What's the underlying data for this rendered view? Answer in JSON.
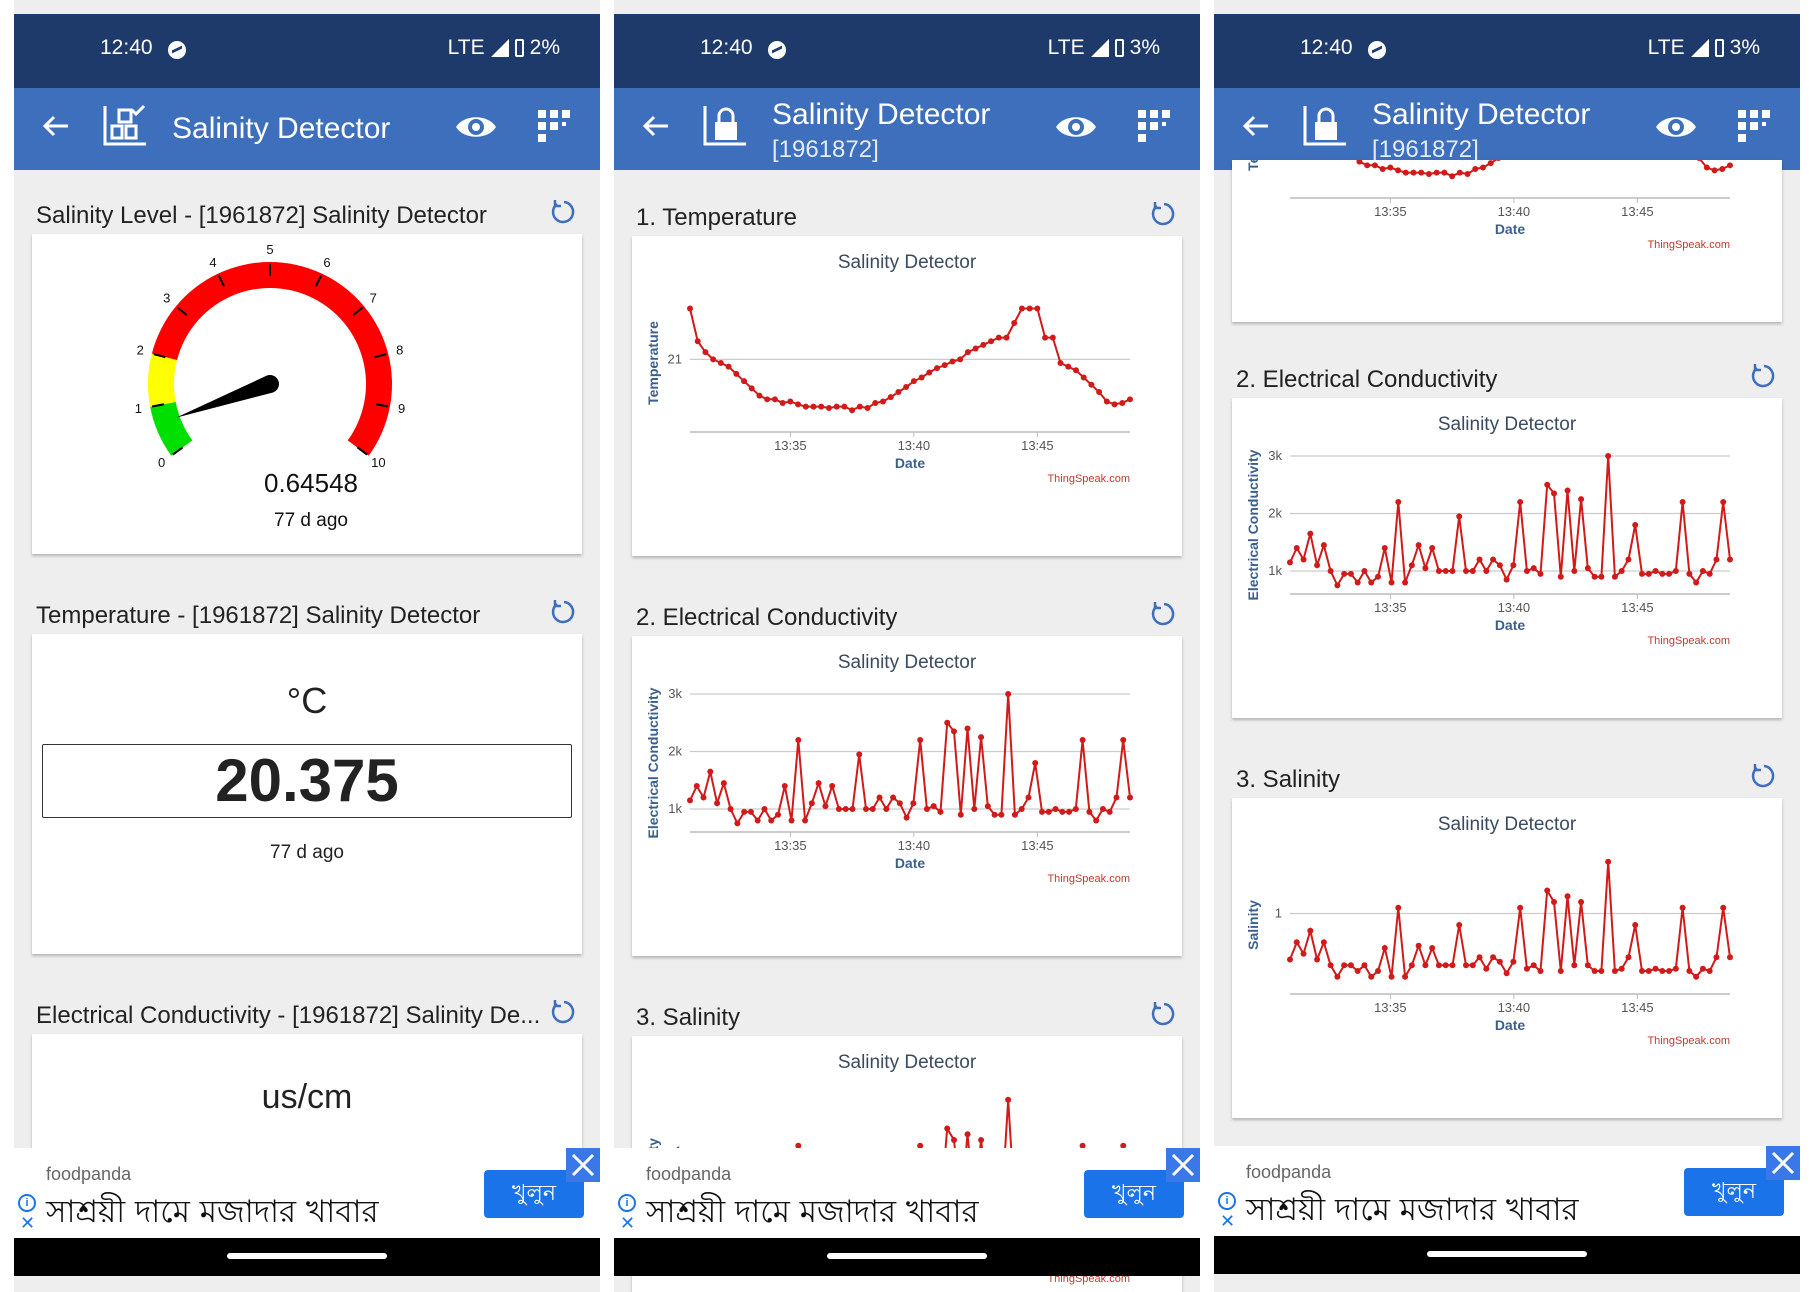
{
  "colors": {
    "status_bar": "#1d3a6b",
    "app_bar": "#3d6fbd",
    "series": "#d11a1a",
    "gauge_red": "#ff0000",
    "gauge_yellow": "#ffff00",
    "gauge_green": "#00e000",
    "ad_button": "#1a73e8"
  },
  "screens": [
    {
      "status": {
        "time": "12:40",
        "network": "LTE",
        "battery": "2%"
      },
      "appbar": {
        "title": "Salinity Detector",
        "icons": [
          "back-arrow-icon",
          "dashboard-icon",
          "eye-icon",
          "qr-code-icon"
        ]
      },
      "sections": {
        "gauge": {
          "title": "Salinity Level - [1961872] Salinity Detector",
          "ticks": [
            "0",
            "1",
            "2",
            "3",
            "4",
            "5",
            "6",
            "7",
            "8",
            "9",
            "10"
          ],
          "value_text": "0.64548",
          "value": 0.64548,
          "min": 0,
          "max": 10,
          "ago": "77 d ago"
        },
        "numeric": {
          "title": "Temperature - [1961872] Salinity Detector",
          "unit": "°C",
          "value": "20.375",
          "ago": "77 d ago"
        },
        "partial": {
          "title": "Electrical Conductivity - [1961872] Salinity De...",
          "unit": "us/cm"
        }
      },
      "ad": {
        "brand": "foodpanda",
        "headline": "সাশ্রয়ী দামে মজাদার খাবার",
        "cta": "খুলুন"
      }
    },
    {
      "status": {
        "time": "12:40",
        "network": "LTE",
        "battery": "3%"
      },
      "appbar": {
        "title": "Salinity Detector",
        "subtitle": "[1961872]",
        "icons": [
          "back-arrow-icon",
          "lock-icon",
          "eye-icon",
          "qr-code-icon"
        ]
      },
      "sections": [
        {
          "title": "1. Temperature"
        },
        {
          "title": "2. Electrical Conductivity"
        },
        {
          "title": "3. Salinity"
        }
      ],
      "ad": {
        "brand": "foodpanda",
        "headline": "সাশ্রয়ী দামে মজাদার খাবার",
        "cta": "খুলুন"
      }
    },
    {
      "status": {
        "time": "12:40",
        "network": "LTE",
        "battery": "3%"
      },
      "appbar": {
        "title": "Salinity Detector",
        "subtitle": "[1961872]",
        "icons": [
          "back-arrow-icon",
          "lock-icon",
          "eye-icon",
          "qr-code-icon"
        ]
      },
      "sections": [
        {
          "title": "2. Electrical Conductivity"
        },
        {
          "title": "3. Salinity"
        }
      ],
      "partial_axis_label": "Te",
      "ad": {
        "brand": "foodpanda",
        "headline": "সাশ্রয়ী দামে মজাদার খাবার",
        "cta": "খুলুন"
      }
    }
  ],
  "chart_data": [
    {
      "id": "temperature",
      "type": "line",
      "title": "Salinity Detector",
      "xlabel": "Date",
      "ylabel": "Temperature",
      "x_ticks": [
        "13:35",
        "13:40",
        "13:45"
      ],
      "x_tick_positions": [
        13,
        29,
        45
      ],
      "y_ticks": [
        "21"
      ],
      "y_tick_values": [
        21
      ],
      "ylim": [
        20.0,
        21.9
      ],
      "xlim": [
        0,
        57
      ],
      "grid": true,
      "legend": false,
      "credit": "ThingSpeak.com",
      "series": [
        {
          "values": [
            21.7,
            21.25,
            21.1,
            21.0,
            20.95,
            20.9,
            20.8,
            20.7,
            20.6,
            20.5,
            20.45,
            20.45,
            20.4,
            20.42,
            20.38,
            20.35,
            20.35,
            20.35,
            20.33,
            20.35,
            20.35,
            20.3,
            20.35,
            20.33,
            20.4,
            20.42,
            20.48,
            20.55,
            20.62,
            20.7,
            20.75,
            20.82,
            20.88,
            20.92,
            20.97,
            21.0,
            21.1,
            21.15,
            21.2,
            21.25,
            21.3,
            21.3,
            21.5,
            21.7,
            21.7,
            21.7,
            21.3,
            21.3,
            20.95,
            20.9,
            20.85,
            20.75,
            20.65,
            20.55,
            20.42,
            20.38,
            20.4,
            20.45
          ]
        }
      ]
    },
    {
      "id": "electrical_conductivity",
      "type": "line",
      "title": "Salinity Detector",
      "xlabel": "Date",
      "ylabel": "Electrical Conductivity",
      "x_ticks": [
        "13:35",
        "13:40",
        "13:45"
      ],
      "x_tick_positions": [
        13,
        29,
        45
      ],
      "y_ticks": [
        "1k",
        "2k",
        "3k"
      ],
      "y_tick_values": [
        1000,
        2000,
        3000
      ],
      "ylim": [
        600,
        3000
      ],
      "xlim": [
        0,
        57
      ],
      "grid": true,
      "legend": false,
      "credit": "ThingSpeak.com",
      "series": [
        {
          "values": [
            1150,
            1400,
            1200,
            1650,
            1100,
            1450,
            1000,
            750,
            950,
            950,
            800,
            1000,
            800,
            900,
            1400,
            800,
            2200,
            800,
            1100,
            1450,
            1050,
            1400,
            1000,
            1000,
            1000,
            1950,
            1000,
            1000,
            1200,
            1000,
            1200,
            1100,
            850,
            1100,
            2200,
            1000,
            1050,
            950,
            2500,
            2350,
            900,
            2400,
            1000,
            2250,
            1050,
            900,
            900,
            3000,
            900,
            1000,
            1200,
            1800,
            950,
            950,
            1000,
            950,
            950,
            1000,
            2200,
            950,
            800,
            1000,
            950,
            1200,
            2200,
            1200
          ]
        }
      ]
    },
    {
      "id": "salinity",
      "type": "line",
      "title": "Salinity Detector",
      "xlabel": "Date",
      "ylabel": "Salinity",
      "x_ticks": [
        "13:35",
        "13:40",
        "13:45"
      ],
      "x_tick_positions": [
        13,
        29,
        45
      ],
      "y_ticks": [
        "1"
      ],
      "y_tick_values": [
        1
      ],
      "ylim": [
        0.3,
        1.5
      ],
      "xlim": [
        0,
        57
      ],
      "grid": true,
      "legend": false,
      "credit": "ThingSpeak.com",
      "series": [
        {
          "values": [
            0.6,
            0.75,
            0.65,
            0.85,
            0.6,
            0.75,
            0.55,
            0.45,
            0.55,
            0.55,
            0.5,
            0.55,
            0.45,
            0.5,
            0.7,
            0.45,
            1.05,
            0.45,
            0.55,
            0.72,
            0.55,
            0.7,
            0.55,
            0.55,
            0.55,
            0.9,
            0.55,
            0.55,
            0.62,
            0.52,
            0.62,
            0.58,
            0.48,
            0.58,
            1.05,
            0.52,
            0.55,
            0.5,
            1.2,
            1.1,
            0.5,
            1.15,
            0.55,
            1.1,
            0.55,
            0.5,
            0.5,
            1.45,
            0.5,
            0.52,
            0.62,
            0.9,
            0.5,
            0.5,
            0.52,
            0.5,
            0.5,
            0.52,
            1.05,
            0.5,
            0.45,
            0.52,
            0.5,
            0.62,
            1.05,
            0.62
          ]
        }
      ]
    }
  ]
}
